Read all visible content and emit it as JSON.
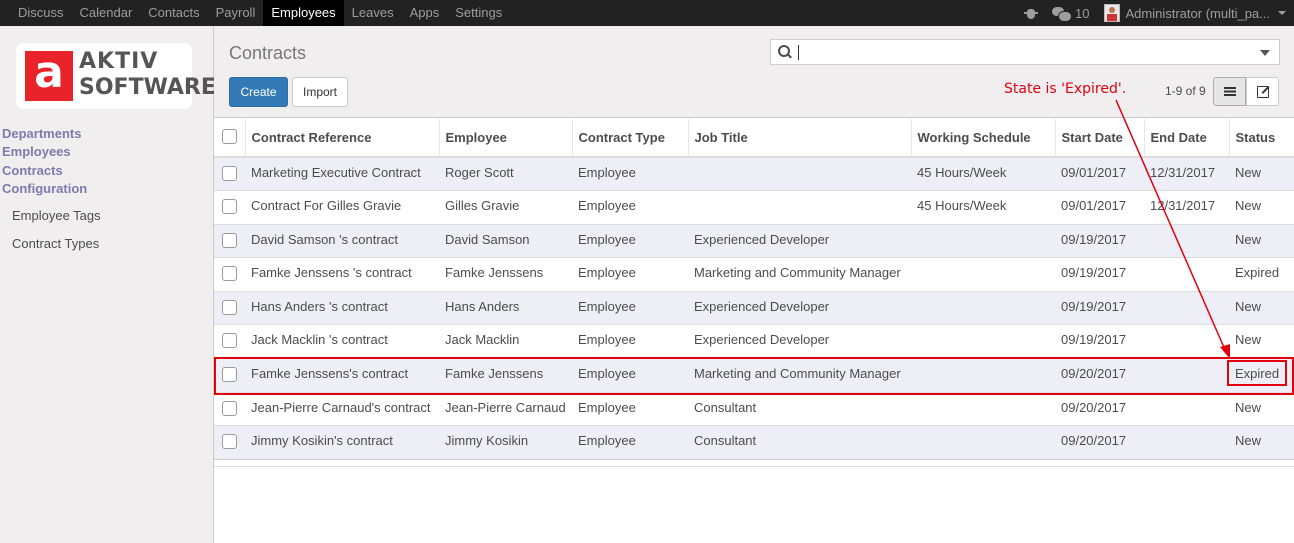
{
  "topnav": {
    "items": [
      "Discuss",
      "Calendar",
      "Contacts",
      "Payroll",
      "Employees",
      "Leaves",
      "Apps",
      "Settings"
    ],
    "active": "Employees",
    "message_count": "10",
    "user": "Administrator (multi_pa..."
  },
  "logo": {
    "line1": "AKTIV",
    "line2": "SOFTWARE",
    "mark": "a"
  },
  "sidebar": {
    "sections": [
      "Departments",
      "Employees",
      "Contracts",
      "Configuration"
    ],
    "sub_items": [
      "Employee Tags",
      "Contract Types"
    ]
  },
  "control_panel": {
    "title": "Contracts",
    "search_value": "",
    "create_label": "Create",
    "import_label": "Import",
    "pager": "1-9 of 9"
  },
  "table": {
    "columns": [
      "Contract Reference",
      "Employee",
      "Contract Type",
      "Job Title",
      "Working Schedule",
      "Start Date",
      "End Date",
      "Status"
    ],
    "rows": [
      [
        "Marketing Executive Contract",
        "Roger Scott",
        "Employee",
        "",
        "45 Hours/Week",
        "09/01/2017",
        "12/31/2017",
        "New"
      ],
      [
        "Contract For Gilles Gravie",
        "Gilles Gravie",
        "Employee",
        "",
        "45 Hours/Week",
        "09/01/2017",
        "12/31/2017",
        "New"
      ],
      [
        "David Samson 's contract",
        "David Samson",
        "Employee",
        "Experienced Developer",
        "",
        "09/19/2017",
        "",
        "New"
      ],
      [
        "Famke Jenssens 's contract",
        "Famke Jenssens",
        "Employee",
        "Marketing and Community Manager",
        "",
        "09/19/2017",
        "",
        "Expired"
      ],
      [
        "Hans Anders 's contract",
        "Hans Anders",
        "Employee",
        "Experienced Developer",
        "",
        "09/19/2017",
        "",
        "New"
      ],
      [
        "Jack Macklin 's contract",
        "Jack Macklin",
        "Employee",
        "Experienced Developer",
        "",
        "09/19/2017",
        "",
        "New"
      ],
      [
        "Famke Jenssens's contract",
        "Famke Jenssens",
        "Employee",
        "Marketing and Community Manager",
        "",
        "09/20/2017",
        "",
        "Expired"
      ],
      [
        "Jean-Pierre Carnaud's contract",
        "Jean-Pierre Carnaud",
        "Employee",
        "Consultant",
        "",
        "09/20/2017",
        "",
        "New"
      ],
      [
        "Jimmy Kosikin's contract",
        "Jimmy Kosikin",
        "Employee",
        "Consultant",
        "",
        "09/20/2017",
        "",
        "New"
      ]
    ]
  },
  "annotation": {
    "text": "State is 'Expired'.",
    "color": "#e3000f"
  },
  "colors": {
    "primary_button": "#337ab7",
    "sidebar_heading": "#7c7bad",
    "navbar": "#222222"
  }
}
